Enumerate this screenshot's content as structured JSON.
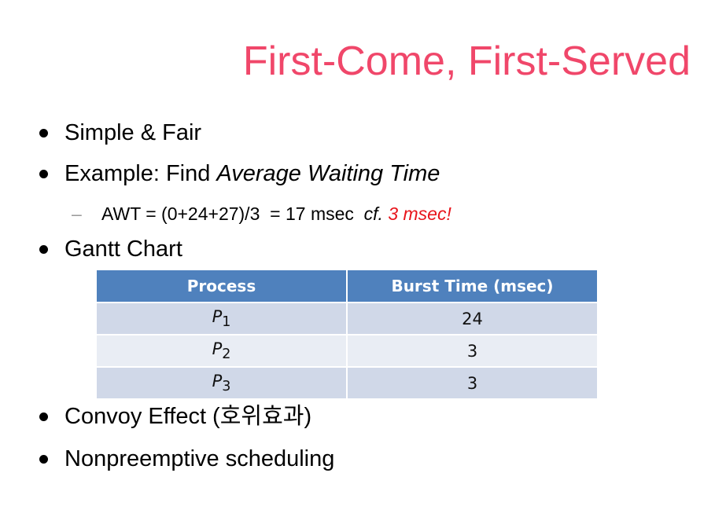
{
  "slide": {
    "title": "First-Come, First-Served",
    "bullets": [
      {
        "text": "Simple & Fair"
      },
      {
        "prefix": "Example: Find ",
        "emph": "Average Waiting Time"
      },
      {
        "text": "Gantt Chart"
      },
      {
        "text": "Convoy Effect (호위효과)"
      },
      {
        "text": "Nonpreemptive scheduling"
      }
    ],
    "sub_bullet": {
      "dash": "–",
      "main": "AWT = (0+24+27)/3  = 17 msec  ",
      "cf": "cf.",
      "highlight": "3 msec!"
    },
    "table": {
      "headers": [
        "Process",
        "Burst Time (msec)"
      ],
      "rows": [
        {
          "process": "P",
          "sub": "1",
          "burst": "24"
        },
        {
          "process": "P",
          "sub": "2",
          "burst": "3"
        },
        {
          "process": "P",
          "sub": "3",
          "burst": "3"
        }
      ],
      "colors": {
        "header": "#4f81bd",
        "row_odd": "#d0d8e8",
        "row_even": "#e9edf4"
      }
    },
    "colors": {
      "title": "#f0476a",
      "highlight": "#e8141b"
    }
  }
}
